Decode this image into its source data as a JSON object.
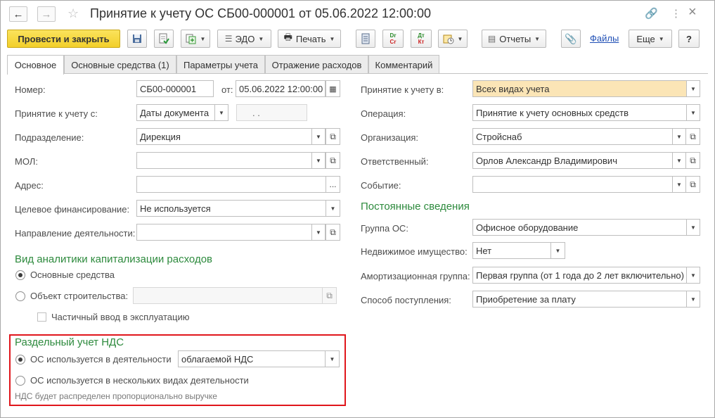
{
  "window": {
    "title": "Принятие к учету ОС СБ00-000001 от 05.06.2022 12:00:00",
    "close_glyph": "×",
    "more_glyph": "⋮"
  },
  "toolbar": {
    "post_close": "Провести и закрыть",
    "edo": "ЭДО",
    "print": "Печать",
    "reports": "Отчеты",
    "files": "Файлы",
    "more": "Еще",
    "help": "?",
    "dr_cr_top": "Dr",
    "dr_cr_bottom": "Cr",
    "dt_kt_top": "Дт",
    "dt_kt_bottom": "Кт"
  },
  "tabs": [
    {
      "label": "Основное"
    },
    {
      "label": "Основные средства (1)"
    },
    {
      "label": "Параметры учета"
    },
    {
      "label": "Отражение расходов"
    },
    {
      "label": "Комментарий"
    }
  ],
  "left": {
    "number_label": "Номер:",
    "number_value": "СБ00-000001",
    "date_label": "от:",
    "date_value": "05.06.2022 12:00:00",
    "accept_label": "Принятие к учету с:",
    "accept_value": "Даты документа",
    "accept_date_value": ".   .",
    "dept_label": "Подразделение:",
    "dept_value": "Дирекция",
    "mol_label": "МОЛ:",
    "mol_value": "",
    "address_label": "Адрес:",
    "address_value": "",
    "address_btn": "...",
    "funding_label": "Целевое финансирование:",
    "funding_value": "Не используется",
    "direction_label": "Направление деятельности:",
    "direction_value": ""
  },
  "capitalization": {
    "heading": "Вид аналитики капитализации расходов",
    "option_os": "Основные средства",
    "option_construction": "Объект строительства:",
    "construction_value": "",
    "partial": "Частичный ввод в эксплуатацию"
  },
  "vat": {
    "heading": "Раздельный учет НДС",
    "option_activity": "ОС используется в деятельности",
    "activity_value": "облагаемой НДС",
    "option_multi": "ОС используется в нескольких видах деятельности",
    "note": "НДС будет распределен пропорционально выручке"
  },
  "right": {
    "accept_in_label": "Принятие к учету в:",
    "accept_in_value": "Всех видах учета",
    "operation_label": "Операция:",
    "operation_value": "Принятие к учету основных средств",
    "org_label": "Организация:",
    "org_value": "Стройснаб",
    "responsible_label": "Ответственный:",
    "responsible_value": "Орлов Александр Владимирович",
    "event_label": "Событие:",
    "event_value": ""
  },
  "permanent": {
    "heading": "Постоянные сведения",
    "group_label": "Группа ОС:",
    "group_value": "Офисное оборудование",
    "realestate_label": "Недвижимое имущество:",
    "realestate_value": "Нет",
    "amort_label": "Амортизационная группа:",
    "amort_value": "Первая группа (от 1 года до 2 лет включительно)",
    "receipt_label": "Способ поступления:",
    "receipt_value": "Приобретение за плату"
  },
  "colors": {
    "accent_yellow": "#f2cf2a",
    "section_green": "#2d8a3d",
    "highlight_red": "#e0161c",
    "link_blue": "#1f4fb5"
  }
}
